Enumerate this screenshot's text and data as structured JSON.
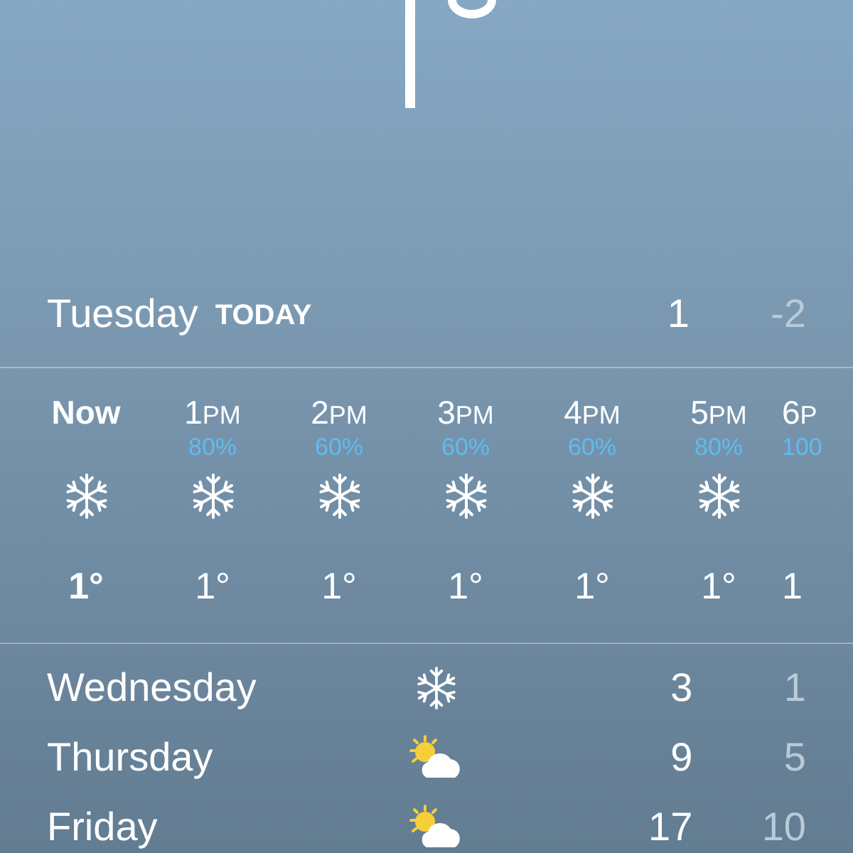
{
  "today": {
    "day": "Tuesday",
    "badge": "TODAY",
    "high": "1",
    "low": "-2"
  },
  "hourly": [
    {
      "hour": "Now",
      "kind": "snow",
      "temp": "1°",
      "current": true
    },
    {
      "hour": "1",
      "period": "PM",
      "chance": "80%",
      "kind": "snow",
      "temp": "1°",
      "current": false
    },
    {
      "hour": "2",
      "period": "PM",
      "chance": "60%",
      "kind": "snow",
      "temp": "1°",
      "current": false
    },
    {
      "hour": "3",
      "period": "PM",
      "chance": "60%",
      "kind": "snow",
      "temp": "1°",
      "current": false
    },
    {
      "hour": "4",
      "period": "PM",
      "chance": "60%",
      "kind": "snow",
      "temp": "1°",
      "current": false
    },
    {
      "hour": "5",
      "period": "PM",
      "chance": "80%",
      "kind": "snow",
      "temp": "1°",
      "current": false
    },
    {
      "hour": "6",
      "period": "P",
      "chance": "100",
      "temp": "1",
      "current": false
    }
  ],
  "daily": [
    {
      "day": "Wednesday",
      "kind": "snow",
      "high": "3",
      "low": "1"
    },
    {
      "day": "Thursday",
      "kind": "partly-cloudy",
      "high": "9",
      "low": "5"
    },
    {
      "day": "Friday",
      "kind": "partly-cloudy",
      "high": "17",
      "low": "10"
    }
  ]
}
